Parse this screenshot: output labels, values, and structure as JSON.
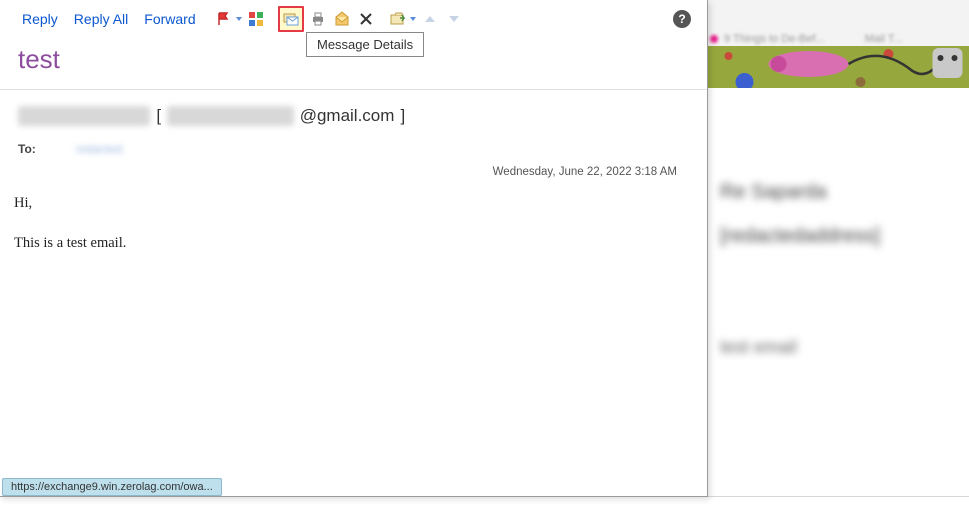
{
  "toolbar": {
    "reply": "Reply",
    "reply_all": "Reply All",
    "forward": "Forward"
  },
  "tooltip": "Message Details",
  "help_glyph": "?",
  "subject": "test",
  "from": {
    "name_redacted": "Redacted Sender",
    "bracket_open": "[",
    "email_local_redacted": "redactedaddress",
    "email_domain": "@gmail.com",
    "bracket_close": "]"
  },
  "to": {
    "label": "To:",
    "value_redacted": "redacted"
  },
  "date": "Wednesday, June 22, 2022 3:18 AM",
  "body": {
    "line1": "Hi,",
    "line2": "This is a test email."
  },
  "status_url": "https://exchange9.win.zerolag.com/owa...",
  "bg": {
    "tab1": "9 Things to De-Bef...",
    "tab2": "Mail T...",
    "subject": "Re Saparda  [redactedaddress]",
    "snippet": "test email"
  }
}
